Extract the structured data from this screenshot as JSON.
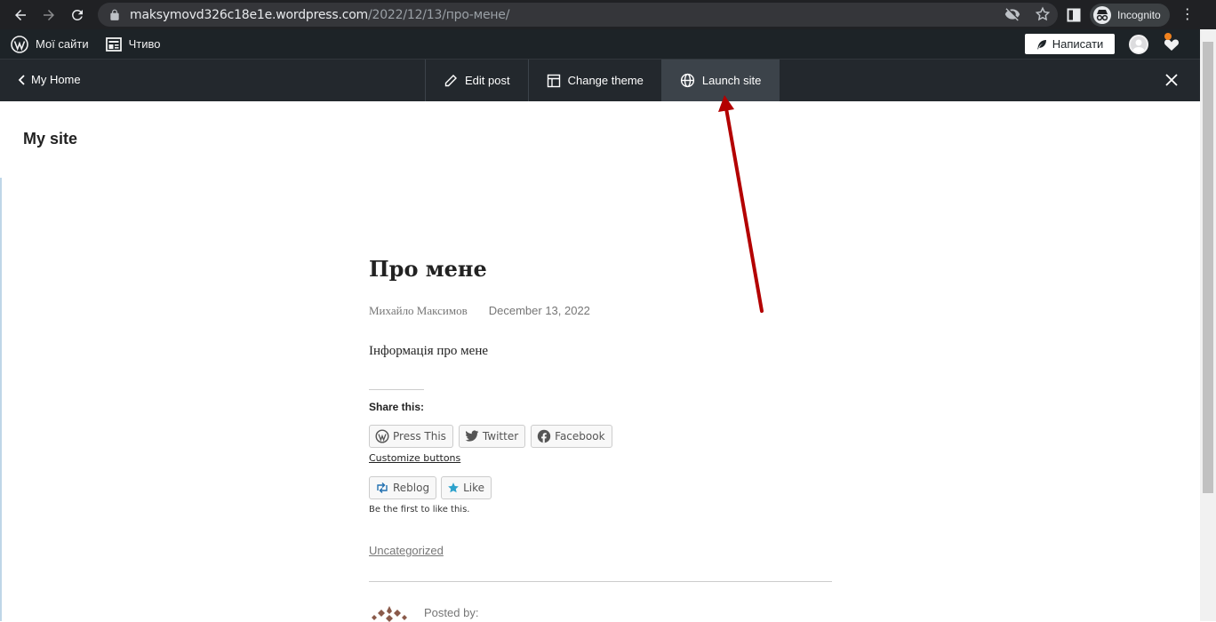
{
  "browser": {
    "url_host": "maksymovd326c18e1e.wordpress.com",
    "url_path": "/2022/12/13/про-мене/",
    "profile_label": "Incognito",
    "icons": [
      "back-icon",
      "forward-icon",
      "reload-icon",
      "lock-icon",
      "eye-off-icon",
      "star-icon",
      "side-panel-icon",
      "incognito-icon",
      "kebab-menu-icon"
    ]
  },
  "wp_admin_bar": {
    "my_sites": "Мої сайти",
    "reader": "Чтиво",
    "write": "Написати"
  },
  "site_toolbar": {
    "my_home": "My Home",
    "edit_post": "Edit post",
    "change_theme": "Change theme",
    "launch_site": "Launch site"
  },
  "page": {
    "site_title": "My site",
    "post_title": "Про мене",
    "author": "Михайло Максимов",
    "date": "December 13, 2022",
    "body": "Інформація про мене",
    "share_title": "Share this:",
    "share_buttons": {
      "press_this": "Press This",
      "twitter": "Twitter",
      "facebook": "Facebook"
    },
    "customize": "Customize buttons",
    "reblog": "Reblog",
    "like": "Like",
    "first_like": "Be the first to like this.",
    "category": "Uncategorized",
    "posted_by": "Posted by:"
  },
  "colors": {
    "chrome_bg": "#202124",
    "admin_bar_bg": "#1d2327",
    "toolbar_bg": "#23282d",
    "active_tool_bg": "#3c434a",
    "annotation_arrow": "#b30000"
  }
}
